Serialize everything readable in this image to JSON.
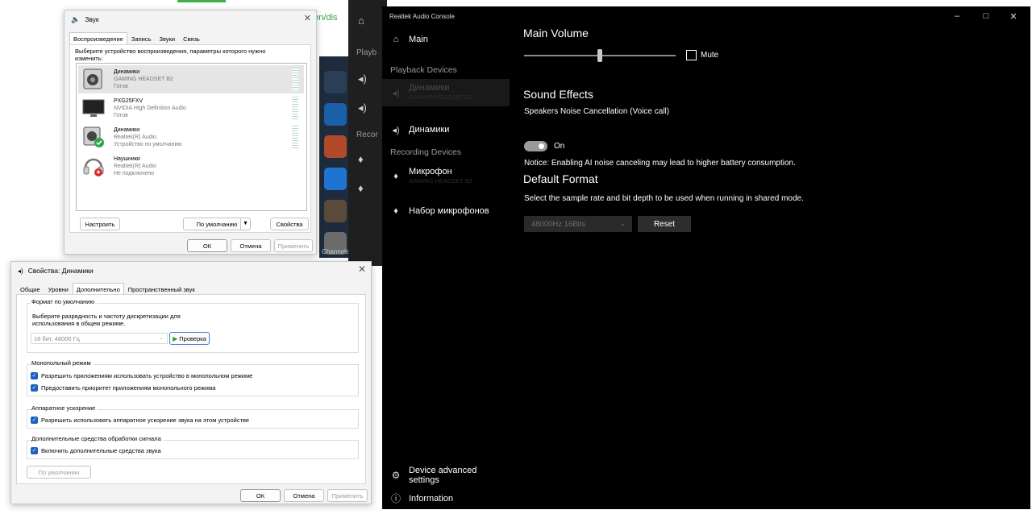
{
  "background": {
    "link_text": "n/en/dis",
    "dark_app": {
      "labels": [
        "Playb",
        "Recor"
      ]
    },
    "strip_label": "Channels"
  },
  "realtek": {
    "title": "Realtek Audio Console",
    "window_controls": {
      "minimize": "–",
      "maximize": "□",
      "close": "✕"
    },
    "sidebar": {
      "main": "Main",
      "playback_header": "Playback Devices",
      "playback_devices": [
        {
          "name": "Динамики",
          "sub": "GAMING HEADSET B2"
        },
        {
          "name": "Динамики",
          "sub": ""
        }
      ],
      "recording_header": "Recording Devices",
      "recording_devices": [
        {
          "name": "Микрофон",
          "sub": "GAMING HEADSET B2"
        },
        {
          "name": "Набор микрофонов",
          "sub": ""
        }
      ],
      "footer": {
        "advanced": "Device advanced settings",
        "information": "Information"
      }
    },
    "main": {
      "main_volume_title": "Main Volume",
      "volume_level_percent": 50,
      "mute_label": "Mute",
      "mute_checked": false,
      "sound_effects_title": "Sound Effects",
      "noise_cancel_label": "Speakers Noise Cancellation (Voice call)",
      "toggle_state": "On",
      "notice": "Notice: Enabling AI noise canceling may lead to higher battery consumption.",
      "default_format_title": "Default Format",
      "format_desc": "Select the sample rate and bit depth to be used when running in shared mode.",
      "format_value": "48000Hz 16Bits",
      "reset_label": "Reset"
    }
  },
  "sound_dialog": {
    "title": "Звук",
    "close": "✕",
    "tabs": [
      "Воспроизведение",
      "Запись",
      "Звуки",
      "Связь"
    ],
    "instruction": "Выберите устройство воспроизведения, параметры которого нужно изменить:",
    "devices": [
      {
        "name": "Динамики",
        "line2": "GAMING HEADSET B2",
        "line3": "Готов",
        "icon": "speaker-icon"
      },
      {
        "name": "PXG25FXV",
        "line2": "NVIDIA High Definition Audio",
        "line3": "Готов",
        "icon": "monitor-icon"
      },
      {
        "name": "Динамики",
        "line2": "Realtek(R) Audio",
        "line3": "Устройство по умолчанию",
        "icon": "speaker-default-icon"
      },
      {
        "name": "Наушники",
        "line2": "Realtek(R) Audio",
        "line3": "Не подключено",
        "icon": "headphones-icon"
      }
    ],
    "buttons": {
      "configure": "Настроить",
      "set_default": "По умолчанию",
      "properties": "Свойства",
      "ok": "ОК",
      "cancel": "Отмена",
      "apply": "Применить"
    }
  },
  "props_dialog": {
    "title": "Свойства: Динамики",
    "close": "✕",
    "tabs": [
      "Общие",
      "Уровни",
      "Дополнительно",
      "Пространственный звук"
    ],
    "default_format": {
      "group": "Формат по умолчанию",
      "desc": "Выберите разрядность и частоту дискретизации для использования в общем режиме.",
      "select_value": "16 бит, 48000 Гц",
      "test_label": "Проверка"
    },
    "exclusive": {
      "group": "Монопольный режим",
      "opt1": "Разрешить приложениям использовать устройство в монопольном режиме",
      "opt2": "Предоставить приоритет приложениям монопольного режима"
    },
    "hw_accel": {
      "group": "Аппаратное ускорение",
      "opt1": "Разрешить использовать аппаратное ускорение звука на этом устройстве"
    },
    "enhancements": {
      "group": "Дополнительные средства обработки сигнала",
      "opt1": "Включить дополнительные средства звука"
    },
    "buttons": {
      "defaults": "По умолчанию",
      "ok": "ОК",
      "cancel": "Отмена",
      "apply": "Применить"
    }
  }
}
